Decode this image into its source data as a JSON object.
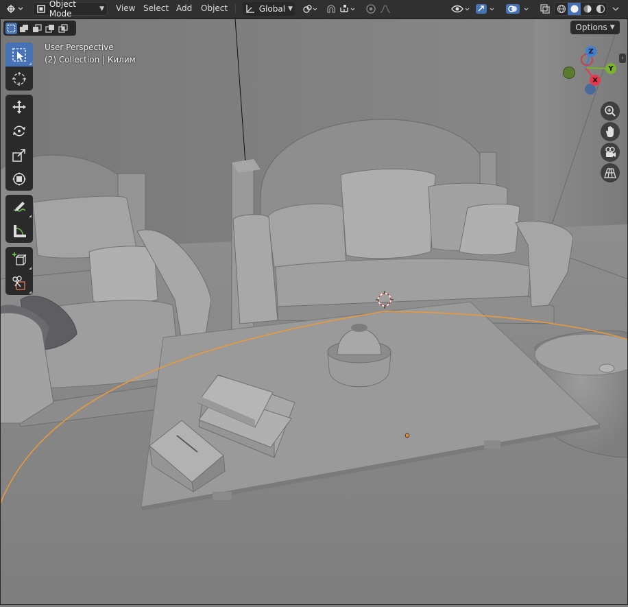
{
  "header": {
    "mode_label": "Object Mode",
    "menu": [
      "View",
      "Select",
      "Add",
      "Object"
    ],
    "orientation_label": "Global"
  },
  "viewport": {
    "options_label": "Options",
    "info_line1": "User Perspective",
    "info_line2": "(2) Collection | Килим"
  },
  "gizmo": {
    "x": "X",
    "y": "Y",
    "z": "Z"
  },
  "toolbar": {
    "tools": [
      "select-box",
      "cursor",
      "move",
      "rotate",
      "scale",
      "transform",
      "annotate",
      "measure",
      "add-cube",
      "add-cut"
    ],
    "active_tool": "select-box"
  },
  "colors": {
    "accent": "#4772b3",
    "axis_x": "#e8384f",
    "axis_y": "#7ab32d",
    "axis_z": "#3c7fd4",
    "selection_outline": "#e89a3c"
  }
}
